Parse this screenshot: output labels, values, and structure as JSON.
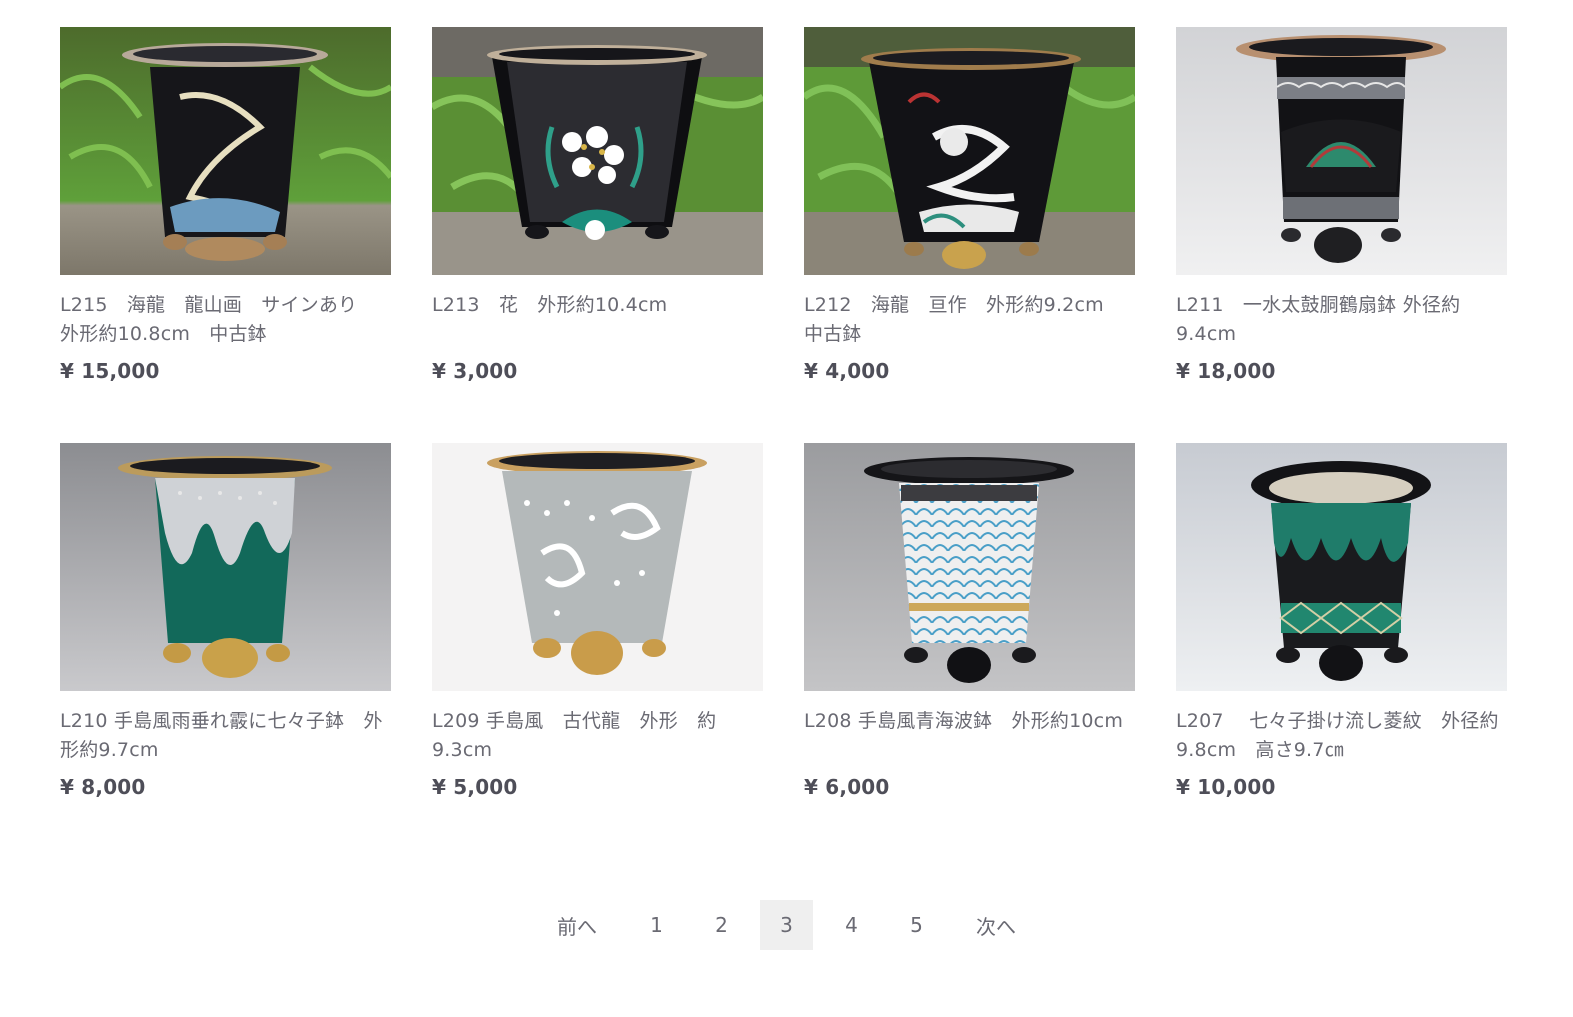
{
  "products": [
    {
      "title": "L215　海龍　龍山画　サインあり　外形約10.8cm　中古鉢",
      "price": "¥ 15,000",
      "image": "black pot with gold dragon, ferns background",
      "icon": "pot-photo-dragon"
    },
    {
      "title": "L213　花　外形約10.4cm",
      "price": "¥ 3,000",
      "image": "black pot with white flowers, ferns background",
      "icon": "pot-photo-flower"
    },
    {
      "title": "L212　海龍　亘作　外形約9.2cm　中古鉢",
      "price": "¥ 4,000",
      "image": "black pot with white dragon, ferns background",
      "icon": "pot-photo-dragon"
    },
    {
      "title": "L211　一水太鼓胴鶴扇鉢 外径約9.4cm",
      "price": "¥ 18,000",
      "image": "black drum pot with fan pattern, grey background",
      "icon": "pot-photo-fan"
    },
    {
      "title": "L210 手島風雨垂れ霰に七々子鉢　外形約9.7cm",
      "price": "¥ 8,000",
      "image": "green pot with white drip glaze, grey background",
      "icon": "pot-photo-drip"
    },
    {
      "title": "L209 手島風　古代龍　外形　約9.3cm",
      "price": "¥ 5,000",
      "image": "grey pot with white dragons, white background",
      "icon": "pot-photo-ancient-dragon"
    },
    {
      "title": "L208 手島風青海波鉢　外形約10cm",
      "price": "¥ 6,000",
      "image": "pot with blue wave pattern, grey background",
      "icon": "pot-photo-wave"
    },
    {
      "title": "L207　 七々子掛け流し菱紋　外径約9.8cm　高さ9.7㎝",
      "price": "¥ 10,000",
      "image": "black and green pot with diamond pattern, grey background",
      "icon": "pot-photo-diamond"
    }
  ],
  "pagination": {
    "prev": "前へ",
    "pages": [
      "1",
      "2",
      "3",
      "4",
      "5"
    ],
    "current": "3",
    "next": "次へ"
  },
  "colors": {
    "text": "#6a6a73",
    "price": "#4e4e58",
    "active_page_bg": "#efefef"
  }
}
